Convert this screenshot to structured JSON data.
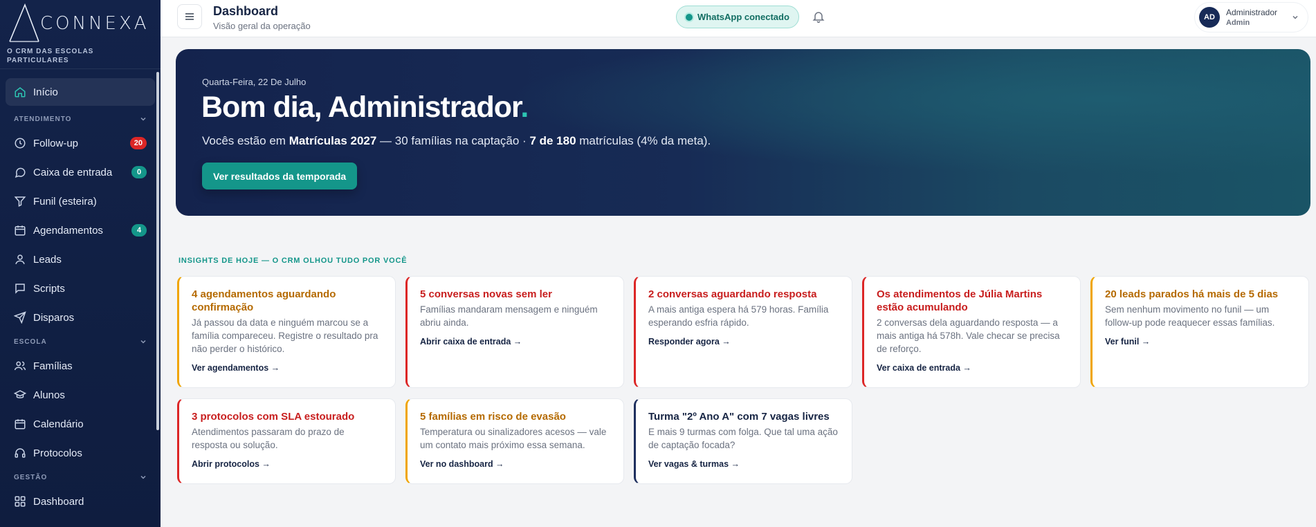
{
  "brand": {
    "name": "CONNEXA",
    "tagline": "O CRM DAS ESCOLAS PARTICULARES"
  },
  "sidebar": {
    "home": {
      "label": "Início",
      "icon": "home-icon"
    },
    "sections": [
      {
        "title": "ATENDIMENTO"
      },
      {
        "title": "ESCOLA"
      },
      {
        "title": "GESTÃO"
      }
    ],
    "atendimento": [
      {
        "label": "Follow-up",
        "icon": "clock-icon",
        "badge": "20",
        "badge_color": "#dc2626"
      },
      {
        "label": "Caixa de entrada",
        "icon": "chat-bubble-icon",
        "badge": "0",
        "badge_color": "#14968a"
      },
      {
        "label": "Funil (esteira)",
        "icon": "funnel-icon"
      },
      {
        "label": "Agendamentos",
        "icon": "calendar-icon",
        "badge": "4",
        "badge_color": "#14968a"
      },
      {
        "label": "Leads",
        "icon": "user-icon"
      },
      {
        "label": "Scripts",
        "icon": "message-square-icon"
      },
      {
        "label": "Disparos",
        "icon": "send-icon"
      }
    ],
    "escola": [
      {
        "label": "Famílias",
        "icon": "users-icon"
      },
      {
        "label": "Alunos",
        "icon": "graduation-cap-icon"
      },
      {
        "label": "Calendário",
        "icon": "calendar-icon"
      },
      {
        "label": "Protocolos",
        "icon": "headset-icon"
      }
    ],
    "gestao": [
      {
        "label": "Dashboard",
        "icon": "grid-icon"
      }
    ]
  },
  "header": {
    "title": "Dashboard",
    "subtitle": "Visão geral da operação",
    "whatsapp_status": "WhatsApp conectado",
    "user": {
      "initials": "AD",
      "name": "Administrador",
      "role": "Admin"
    }
  },
  "hero": {
    "date": "Quarta-Feira, 22 De Julho",
    "greeting": "Bom dia, Administrador",
    "greeting_dot": ".",
    "line_prefix": "Vocês estão em ",
    "season": "Matrículas 2027",
    "line_middle": " — 30 famílias na captação · ",
    "enrolled": "7 de 180",
    "line_suffix": " matrículas (4% da meta).",
    "button": "Ver resultados da temporada"
  },
  "insights": {
    "title": "INSIGHTS DE HOJE — O CRM OLHOU TUDO POR VOCÊ",
    "cards": [
      {
        "tone": "amber",
        "title": "4 agendamentos aguardando confirmação",
        "body": "Já passou da data e ninguém marcou se a família compareceu. Registre o resultado pra não perder o histórico.",
        "link": "Ver agendamentos →"
      },
      {
        "tone": "red",
        "title": "5 conversas novas sem ler",
        "body": "Famílias mandaram mensagem e ninguém abriu ainda.",
        "link": "Abrir caixa de entrada →"
      },
      {
        "tone": "red",
        "title": "2 conversas aguardando resposta",
        "body": "A mais antiga espera há 579 horas. Família esperando esfria rápido.",
        "link": "Responder agora →"
      },
      {
        "tone": "red",
        "title": "Os atendimentos de Júlia Martins estão acumulando",
        "body": "2 conversas dela aguardando resposta — a mais antiga há 578h. Vale checar se precisa de reforço.",
        "link": "Ver caixa de entrada →"
      },
      {
        "tone": "amber",
        "title": "20 leads parados há mais de 5 dias",
        "body": "Sem nenhum movimento no funil — um follow-up pode reaquecer essas famílias.",
        "link": "Ver funil →"
      },
      {
        "tone": "red",
        "title": "3 protocolos com SLA estourado",
        "body": "Atendimentos passaram do prazo de resposta ou solução.",
        "link": "Abrir protocolos →"
      },
      {
        "tone": "amber",
        "title": "5 famílias em risco de evasão",
        "body": "Temperatura ou sinalizadores acesos — vale um contato mais próximo essa semana.",
        "link": "Ver no dashboard →"
      },
      {
        "tone": "navy",
        "title": "Turma \"2º Ano A\" com 7 vagas livres",
        "body": "E mais 9 turmas com folga. Que tal uma ação de captação focada?",
        "link": "Ver vagas & turmas →"
      }
    ]
  },
  "colors": {
    "accent": "#14968a",
    "navy": "#172544",
    "alert": "#dc2626",
    "warning": "#f0a500"
  }
}
